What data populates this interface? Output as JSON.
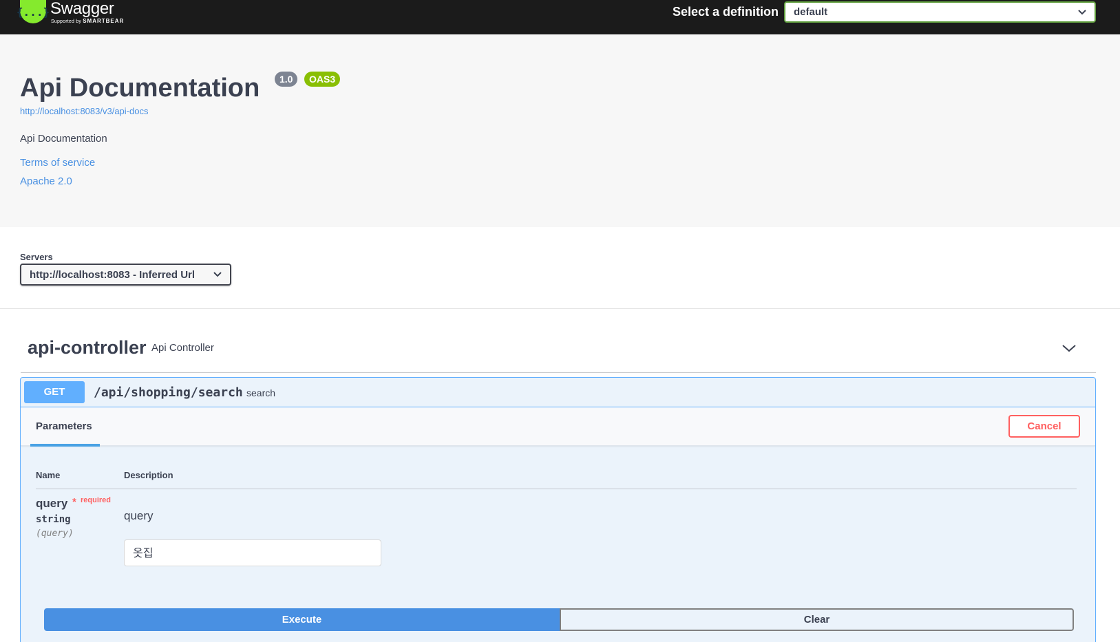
{
  "topbar": {
    "logo_icon": "{...}",
    "logo_name": "Swagger",
    "logo_supported": "Supported by",
    "logo_brand": "SMARTBEAR",
    "definition_label": "Select a definition",
    "definition_value": "default"
  },
  "info": {
    "title": "Api Documentation",
    "version": "1.0",
    "oas": "OAS3",
    "spec_url": "http://localhost:8083/v3/api-docs",
    "description": "Api Documentation",
    "terms": "Terms of service",
    "license": "Apache 2.0"
  },
  "servers": {
    "label": "Servers",
    "selected": "http://localhost:8083 - Inferred Url"
  },
  "tag": {
    "name": "api-controller",
    "description": "Api Controller"
  },
  "operation": {
    "method": "GET",
    "path": "/api/shopping/search",
    "summary": "search",
    "tab": "Parameters",
    "cancel": "Cancel",
    "columns": {
      "name": "Name",
      "description": "Description"
    },
    "parameter": {
      "name": "query",
      "required_star": "*",
      "required_text": "required",
      "type": "string",
      "in": "(query)",
      "description": "query",
      "value": "옷집"
    },
    "execute": "Execute",
    "clear": "Clear"
  },
  "colors": {
    "topbar_bg": "#1b1b1b",
    "info_bg": "#f7f7f7",
    "get_accent": "#61affe",
    "execute_bg": "#4990e2",
    "cancel_red": "#ff6060",
    "badge_oas": "#89bf04",
    "badge_version": "#7d8492"
  }
}
